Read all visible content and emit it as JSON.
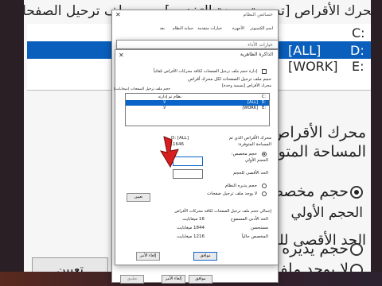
{
  "background": {
    "top_label": "محرك الأقراص [تسمية وحدة التخزين] حجم ملف ترحيل الصفحات",
    "list_rows": [
      {
        "drive": "C:",
        "label": ""
      },
      {
        "drive": "D:",
        "label": "[ALL]"
      },
      {
        "drive": "E:",
        "label": "[WORK]"
      }
    ],
    "drive_label": "محرك الأقراص الذي",
    "space_label": "المساحة المتوفرة:",
    "custom_size": "حجم مخصص:",
    "initial_size": "الحجم الأولي",
    "max_size": "الحد الأقصى للحجم",
    "system_managed": "حجم يديره النظام",
    "no_paging": "لا يوجد ملف ترحيل",
    "set_button": "تعيين"
  },
  "system_props": {
    "title": "خصائص النظام",
    "tabs": [
      "اسم الكمبيوتر",
      "الأجهزة",
      "خيارات متقدمة",
      "حماية النظام",
      "بعد"
    ],
    "ok": "موافق",
    "cancel": "إلغاء الأمر",
    "apply": "تطبيق"
  },
  "perf_options": {
    "title": "خيارات الأداء"
  },
  "virtual_memory": {
    "title": "الذاكرة الظاهرية",
    "auto_manage": "إدارة حجم ملف ترحيل الصفحات لكافة محركات الأقراص تلقائياً",
    "paging_file_size_label": "حجم ملف ترحيل الصفحات لكل محرك أقراص",
    "drive_header": "محرك الأقراص [تسمية وحدة]",
    "size_header": "حجم ملف ترحيل الصفحات (ميجابايت)",
    "drives": [
      {
        "drive": "C:",
        "label": "",
        "size": "نظام تم إدارته"
      },
      {
        "drive": "D:",
        "label": "[ALL]",
        "size": "لا"
      },
      {
        "drive": "E:",
        "label": "[WORK]",
        "size": "لا"
      }
    ],
    "selected_drive_label": "محرك الأقراص الذي تم",
    "selected_drive_value": "D: [ALL]",
    "space_label": "المساحة المتوفرة:",
    "space_value": "111646",
    "custom_size": "حجم مخصص:",
    "initial_size": "الحجم الأولي",
    "max_size": "الحد الأقصى للحجم",
    "system_managed": "حجم يديره النظام",
    "no_paging": "لا يوجد ملف ترحيل صفحات",
    "set_button": "تعيين",
    "totals_title": "إجمالي حجم ملف ترحيل الصفحات لكافة محركات الأقراص",
    "min_allowed_label": "الحد الأدنى المسموح",
    "min_allowed_value": "16 ميغابايت",
    "recommended_label": "مستحسن",
    "recommended_value": "1844 ميغابايت",
    "current_label": "المخصص حالياً",
    "current_value": "1216 ميغابايت",
    "ok": "موافق",
    "cancel": "إلغاء الأمر"
  },
  "colors": {
    "selection": "#0a64c8",
    "arrow": "#d61f1f"
  }
}
